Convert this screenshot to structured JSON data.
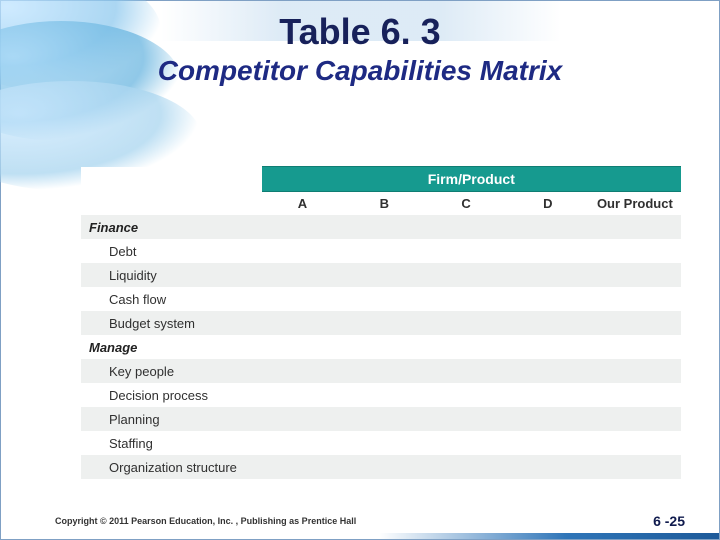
{
  "title": {
    "main": "Table 6. 3",
    "sub": "Competitor Capabilities Matrix"
  },
  "table": {
    "super_header": "Firm/Product",
    "columns": [
      "A",
      "B",
      "C",
      "D",
      "Our Product"
    ],
    "sections": [
      {
        "name": "Finance",
        "rows": [
          "Debt",
          "Liquidity",
          "Cash flow",
          "Budget system"
        ]
      },
      {
        "name": "Manage",
        "rows": [
          "Key people",
          "Decision process",
          "Planning",
          "Staffing",
          "Organization structure"
        ]
      }
    ]
  },
  "footer": {
    "copyright": "Copyright © 2011 Pearson Education, Inc. , Publishing as Prentice Hall",
    "page": "6 -25"
  }
}
